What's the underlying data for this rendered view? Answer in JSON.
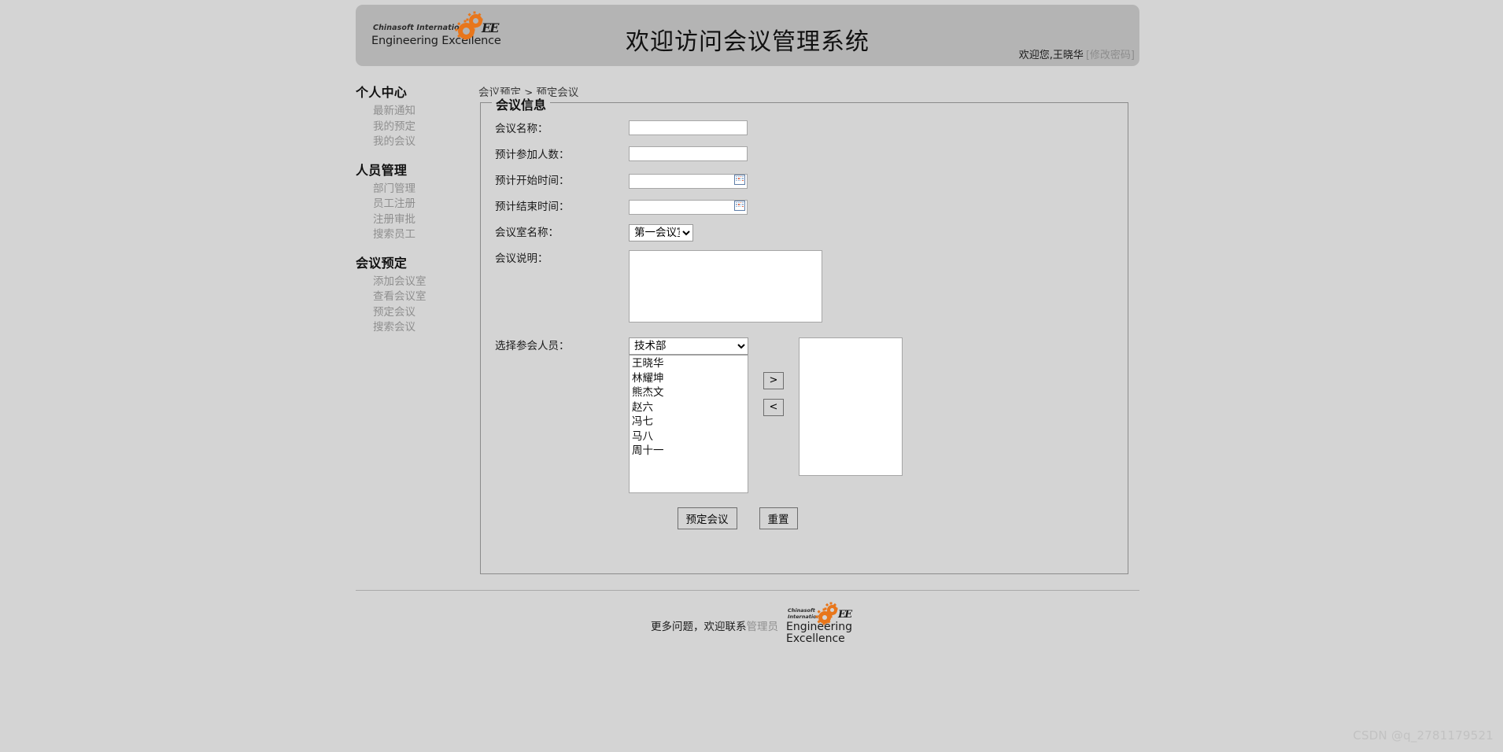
{
  "header": {
    "title": "欢迎访问会议管理系统",
    "welcome_text": "欢迎您,王晓华",
    "change_password": "[修改密码]",
    "logo": {
      "line1": "Chinasoft International",
      "line2": "Engineering Excellence",
      "mark": "EE"
    }
  },
  "sidebar": {
    "groups": [
      {
        "title": "个人中心",
        "items": [
          {
            "label": "最新通知"
          },
          {
            "label": "我的预定"
          },
          {
            "label": "我的会议"
          }
        ]
      },
      {
        "title": "人员管理",
        "items": [
          {
            "label": "部门管理"
          },
          {
            "label": "员工注册"
          },
          {
            "label": "注册审批"
          },
          {
            "label": "搜索员工"
          }
        ]
      },
      {
        "title": "会议预定",
        "items": [
          {
            "label": "添加会议室"
          },
          {
            "label": "查看会议室"
          },
          {
            "label": "预定会议"
          },
          {
            "label": "搜索会议"
          }
        ]
      }
    ]
  },
  "breadcrumb": {
    "root": "会议预定",
    "separator": ">",
    "current": "预定会议"
  },
  "panel": {
    "legend": "会议信息",
    "fields": {
      "meeting_name": {
        "label": "会议名称：",
        "value": "",
        "placeholder": ""
      },
      "attendee_count": {
        "label": "预计参加人数：",
        "value": "",
        "placeholder": ""
      },
      "start_time": {
        "label": "预计开始时间：",
        "value": "",
        "placeholder": ""
      },
      "end_time": {
        "label": "预计结束时间：",
        "value": "",
        "placeholder": ""
      },
      "room_name": {
        "label": "会议室名称：",
        "selected": "第一会议室",
        "options": [
          "第一会议室"
        ]
      },
      "description": {
        "label": "会议说明：",
        "value": "",
        "placeholder": ""
      },
      "participants": {
        "label": "选择参会人员：",
        "department_selected": "技术部",
        "department_options": [
          "技术部"
        ],
        "available": [
          "王晓华",
          "林耀坤",
          "熊杰文",
          "赵六",
          "冯七",
          "马八",
          "周十一"
        ],
        "selected": [],
        "add_button": ">",
        "remove_button": "<"
      }
    },
    "actions": {
      "submit": "预定会议",
      "reset": "重置"
    }
  },
  "footer": {
    "text": "更多问题，欢迎联系",
    "admin_link": "管理员",
    "logo": {
      "line1": "Chinasoft",
      "line1b": "International",
      "line2": "Engineering",
      "line3": "Excellence",
      "mark": "EE"
    }
  },
  "watermark": "CSDN @q_2781179521",
  "colors": {
    "page_background": "#d4d4d4",
    "header_background": "#b4b4b4",
    "link_gray": "#8f8f8f",
    "logo_orange": "#e8761b",
    "border": "#8b8b8b"
  }
}
